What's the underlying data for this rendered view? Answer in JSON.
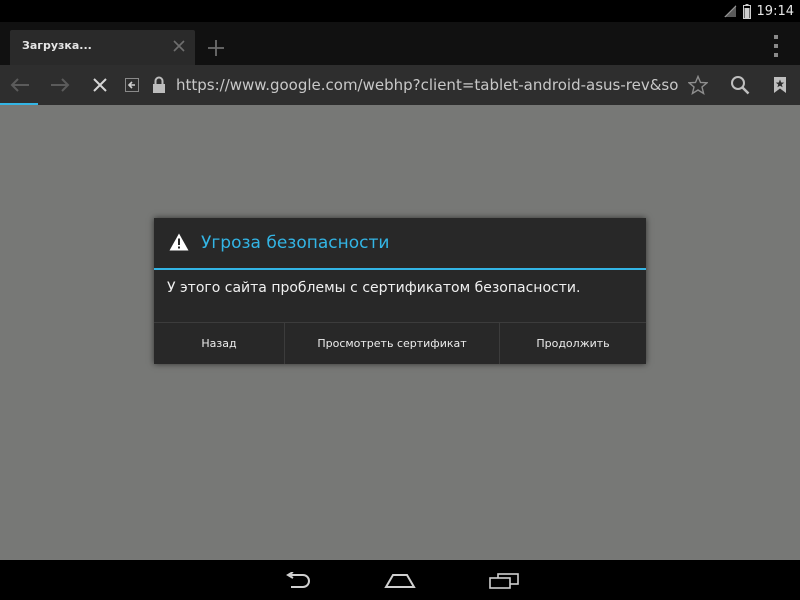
{
  "status_bar": {
    "time": "19:14",
    "icons": [
      "signal-icon",
      "battery-icon"
    ]
  },
  "tab": {
    "title": "Загрузка...",
    "close_icon": "close-icon"
  },
  "toolbar": {
    "url": "https://www.google.com/webhp?client=tablet-android-asus-rev&source=a",
    "icons": [
      "back-icon",
      "forward-icon",
      "stop-icon",
      "incognito-icon",
      "lock-icon",
      "star-icon",
      "search-icon",
      "bookmarks-icon"
    ]
  },
  "dialog": {
    "title": "Угроза безопасности",
    "message": "У этого сайта проблемы с сертификатом безопасности.",
    "buttons": {
      "back": "Назад",
      "view_certificate": "Просмотреть сертификат",
      "continue": "Продолжить"
    }
  },
  "nav_bar": {
    "icons": [
      "nav-back-icon",
      "home-icon",
      "recent-apps-icon"
    ]
  },
  "colors": {
    "accent": "#33b5e5",
    "page_background": "#777876",
    "dialog_background": "#282828"
  }
}
